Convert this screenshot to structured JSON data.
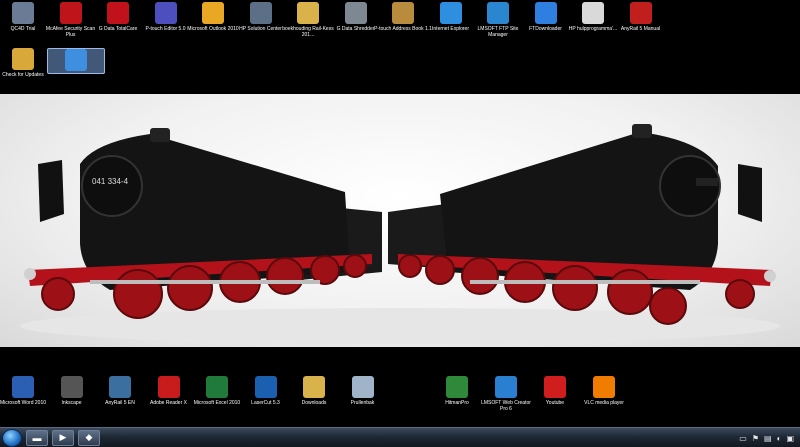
{
  "desktop": {
    "top_icons": [
      {
        "label": "QC4D Trial",
        "icon": "qc4d-icon",
        "color": "#6a7c95"
      },
      {
        "label": "McAfee Security Scan Plus",
        "icon": "mcafee-icon",
        "color": "#c0141b"
      },
      {
        "label": "G Data TotalCare",
        "icon": "gdata-icon",
        "color": "#c1121c"
      },
      {
        "label": "P-touch Editor 5.0",
        "icon": "ptouch-icon",
        "color": "#4d4fbf"
      },
      {
        "label": "Microsoft Outlook 2010",
        "icon": "outlook-icon",
        "color": "#e9a823"
      },
      {
        "label": "HP Solution Center",
        "icon": "hp-solution-icon",
        "color": "#5b6f86"
      },
      {
        "label": "boekhouding Rail-Kess 201...",
        "icon": "folder-icon",
        "color": "#d9b24a"
      },
      {
        "label": "G Data Shredder",
        "icon": "shredder-icon",
        "color": "#7d8893"
      },
      {
        "label": "P-touch Address Book 1.1",
        "icon": "address-book-icon",
        "color": "#b98b3c"
      },
      {
        "label": "Internet Explorer",
        "icon": "ie-icon",
        "color": "#2e8fe0"
      },
      {
        "label": "LMSOFT FTP Site Manager",
        "icon": "ftp-icon",
        "color": "#2a86cf"
      },
      {
        "label": "FTDownloader",
        "icon": "ftdownloader-icon",
        "color": "#2f7fe0"
      },
      {
        "label": "HP hulpprogramma'...",
        "icon": "hp-utility-icon",
        "color": "#d9d9d9"
      },
      {
        "label": "AnyRail 5 Manual",
        "icon": "pdf-icon",
        "color": "#c11e1e"
      }
    ],
    "second_row_icons": [
      {
        "label": "Check for Updates",
        "icon": "updates-icon",
        "color": "#d8a83a"
      },
      {
        "label": "",
        "icon": "shortcut-icon",
        "color": "#3f8fe0",
        "selected": true
      }
    ],
    "bottom_icons_left": [
      {
        "label": "Microsoft Word 2010",
        "icon": "word-icon",
        "color": "#2b5fb4"
      },
      {
        "label": "Inkscape",
        "icon": "inkscape-icon",
        "color": "#555"
      },
      {
        "label": "AnyRail 5 EN",
        "icon": "anyrail-icon",
        "color": "#3a6fa0"
      },
      {
        "label": "Adobe Reader X",
        "icon": "adobe-reader-icon",
        "color": "#c81b1b"
      },
      {
        "label": "Microsoft Excel 2010",
        "icon": "excel-icon",
        "color": "#1f7a3c"
      },
      {
        "label": "LaserCut 5.3",
        "icon": "lasercut-icon",
        "color": "#1b5fb0"
      },
      {
        "label": "Downloads",
        "icon": "downloads-folder-icon",
        "color": "#d8b34b"
      },
      {
        "label": "Prullenbak",
        "icon": "recycle-bin-icon",
        "color": "#9fb4c8"
      }
    ],
    "bottom_icons_right": [
      {
        "label": "HitmanPro",
        "icon": "hitmanpro-icon",
        "color": "#2e8a3a"
      },
      {
        "label": "LMSOFT Web Creator Pro 6",
        "icon": "web-creator-icon",
        "color": "#2a7fd0"
      },
      {
        "label": "Youtube",
        "icon": "youtube-icon",
        "color": "#d01e1e"
      },
      {
        "label": "VLC media player",
        "icon": "vlc-icon",
        "color": "#f07c00"
      }
    ]
  },
  "wallpaper": {
    "left_loco_number": "041 334-4"
  },
  "taskbar": {
    "pinned": [
      {
        "icon": "explorer-folder-icon",
        "glyph": "▬"
      },
      {
        "icon": "media-player-icon",
        "glyph": "▶"
      },
      {
        "icon": "app-icon",
        "glyph": "◆"
      }
    ],
    "tray": [
      {
        "icon": "keyboard-icon",
        "glyph": "▭"
      },
      {
        "icon": "flag-icon",
        "glyph": "⚑"
      },
      {
        "icon": "network-icon",
        "glyph": "▤"
      },
      {
        "icon": "volume-icon",
        "glyph": "◐"
      },
      {
        "icon": "tray-app-icon",
        "glyph": "▣"
      }
    ]
  }
}
